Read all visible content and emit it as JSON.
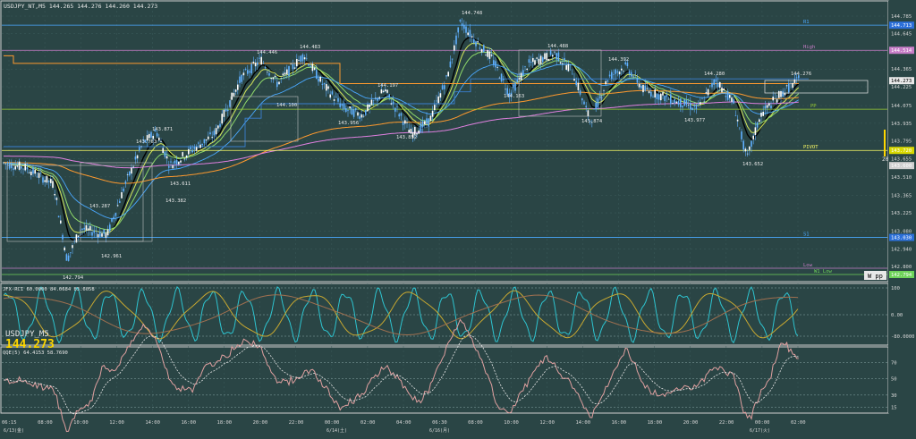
{
  "header": {
    "title": "USDJPY_NT,M5  144.265 144.276 144.260 144.273"
  },
  "symbol_overlay": {
    "name": "USDJPY_M5",
    "price": "144.273"
  },
  "levels": [
    {
      "label": "R1",
      "price": "144.713",
      "color": "#4aa8ff"
    },
    {
      "label": "High",
      "price": "144.514",
      "color": "#c77dc7"
    },
    {
      "label": "PP",
      "price": "144.047",
      "color": "#9acd32"
    },
    {
      "label": "PIVOT",
      "price": "143.720",
      "color": "#ffff66"
    },
    {
      "label": "S1",
      "price": "143.030",
      "color": "#4aa8ff"
    },
    {
      "label": "Low",
      "price": "142.794",
      "color": "#c77dc7"
    },
    {
      "label": "W1 Low",
      "price": "142.794",
      "color": "#6fd35a"
    }
  ],
  "price_axis_ticks": [
    "144.785",
    "144.645",
    "144.505",
    "144.365",
    "144.225",
    "144.075",
    "143.935",
    "143.795",
    "143.655",
    "143.510",
    "143.365",
    "143.225",
    "143.080",
    "142.940",
    "142.800"
  ],
  "current_price": {
    "value": "144.273",
    "color": "#e8e8e8"
  },
  "extra_price_tags": [
    {
      "value": "144.713",
      "color": "#2b6fd9"
    },
    {
      "value": "144.514",
      "color": "#c77dc7"
    },
    {
      "value": "143.720",
      "color": "#d8d800"
    },
    {
      "value": "143.600",
      "color": "#d0d0d0"
    },
    {
      "value": "143.030",
      "color": "#2b6fd9"
    },
    {
      "value": "142.794",
      "color": "#6fd35a"
    }
  ],
  "volume_label": "20",
  "w_pp_label": "W pp",
  "price_annotations": [
    "144.748",
    "144.446",
    "144.483",
    "144.488",
    "144.392",
    "144.280",
    "144.276",
    "143.871",
    "143.763",
    "143.611",
    "143.287",
    "143.382",
    "142.961",
    "142.794",
    "144.197",
    "144.163",
    "144.100",
    "143.956",
    "143.852",
    "143.874",
    "143.977",
    "143.652"
  ],
  "stoch_panel": {
    "title": "JFX-RCI 60.0000 84.0684 83.6058",
    "ticks": [
      "100",
      "0.00",
      "-80.0000"
    ]
  },
  "qqe_panel": {
    "title": "QQE(5) 64.4153 58.7690",
    "ticks": [
      "70",
      "50",
      "30",
      "15"
    ]
  },
  "time_axis": [
    "06:15",
    "08:00",
    "10:00",
    "12:00",
    "14:00",
    "16:00",
    "18:00",
    "20:00",
    "22:00",
    "00:00",
    "02:00",
    "04:00",
    "06:30",
    "08:00",
    "10:00",
    "12:00",
    "14:00",
    "16:00",
    "18:00",
    "20:00",
    "22:00",
    "00:00",
    "02:00"
  ],
  "date_labels": [
    "6/13(金)",
    "6/14(土)",
    "6/16(月)",
    "6/17(火)"
  ],
  "colors": {
    "background": "#2a4545",
    "panel_border": "#d0d0d0",
    "candle": "#5fb0ff",
    "ema_black": "#000000",
    "ema_yellow": "#d6e85a",
    "ema_green": "#8fd96a",
    "ma_orange": "#ff9a2e",
    "ma_pink": "#e080e0",
    "ma_blue": "#4aa8ff",
    "rci_cyan": "#2ec4d0",
    "rci_olive": "#c8a830",
    "rci_brown": "#a07050",
    "qqe_line": "#e0a0a0",
    "qqe_dotted": "#e8e8e8"
  }
}
